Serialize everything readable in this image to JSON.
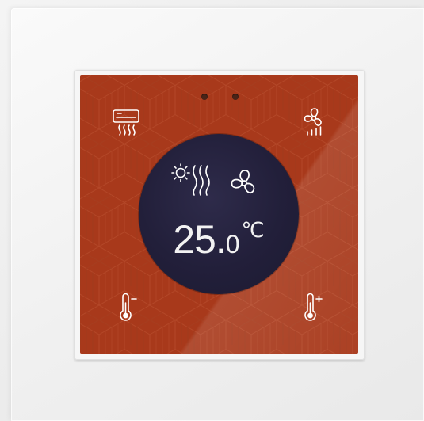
{
  "device": {
    "display": {
      "temperature_integer": "25.",
      "temperature_decimal": "0",
      "temperature_unit": "℃",
      "mode_icons": [
        "sun-heat-icon",
        "fan-icon"
      ]
    },
    "keys": {
      "top_left": "air-conditioner-icon",
      "top_right": "fan-speed-icon",
      "bottom_left": "thermometer-minus-icon",
      "bottom_right": "thermometer-plus-icon"
    },
    "colors": {
      "glass": "#a8391b",
      "screen": "#221f3a",
      "icon": "#ffffff",
      "frame": "#f0f0f0"
    }
  }
}
